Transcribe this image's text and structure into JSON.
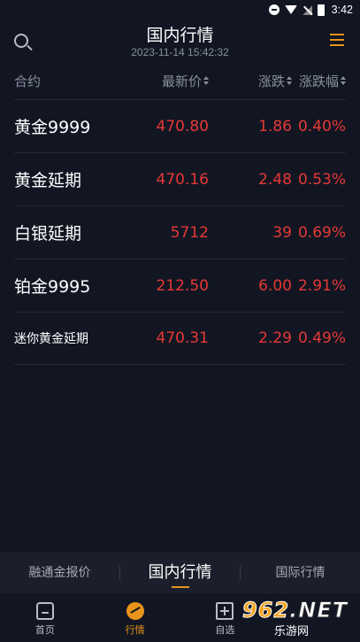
{
  "status_bar": {
    "time": "3:42",
    "icons": [
      "do-not-disturb-icon",
      "wifi-icon",
      "signal-icon",
      "battery-icon"
    ]
  },
  "header": {
    "title": "国内行情",
    "timestamp": "2023-11-14 15:42:32",
    "left_icon": "search-icon",
    "right_icon": "menu-icon"
  },
  "table": {
    "columns": {
      "name": "合约",
      "price": "最新价",
      "change": "涨跌",
      "percent": "涨跌幅"
    },
    "rows": [
      {
        "name": "黄金9999",
        "price": "470.80",
        "change": "1.86",
        "percent": "0.40%"
      },
      {
        "name": "黄金延期",
        "price": "470.16",
        "change": "2.48",
        "percent": "0.53%"
      },
      {
        "name": "白银延期",
        "price": "5712",
        "change": "39",
        "percent": "0.69%"
      },
      {
        "name": "铂金9995",
        "price": "212.50",
        "change": "6.00",
        "percent": "2.91%"
      },
      {
        "name": "迷你黄金延期",
        "price": "470.31",
        "change": "2.29",
        "percent": "0.49%"
      }
    ]
  },
  "market_tabs": [
    {
      "label": "融通金报价"
    },
    {
      "label": "国内行情",
      "active": true
    },
    {
      "label": "国际行情"
    }
  ],
  "bottom_nav": [
    {
      "label": "首页",
      "icon": "home-icon"
    },
    {
      "label": "行情",
      "icon": "market-icon",
      "active": true
    },
    {
      "label": "自选",
      "icon": "watchlist-icon"
    },
    {
      "label": "",
      "icon": ""
    }
  ],
  "watermark": {
    "logo_digits": "962",
    "logo_suffix": ".NET",
    "subtitle": "乐游网"
  },
  "colors": {
    "background": "#121623",
    "accent": "#e8941a",
    "up_red": "#e53935",
    "muted": "#8a8f9c"
  }
}
